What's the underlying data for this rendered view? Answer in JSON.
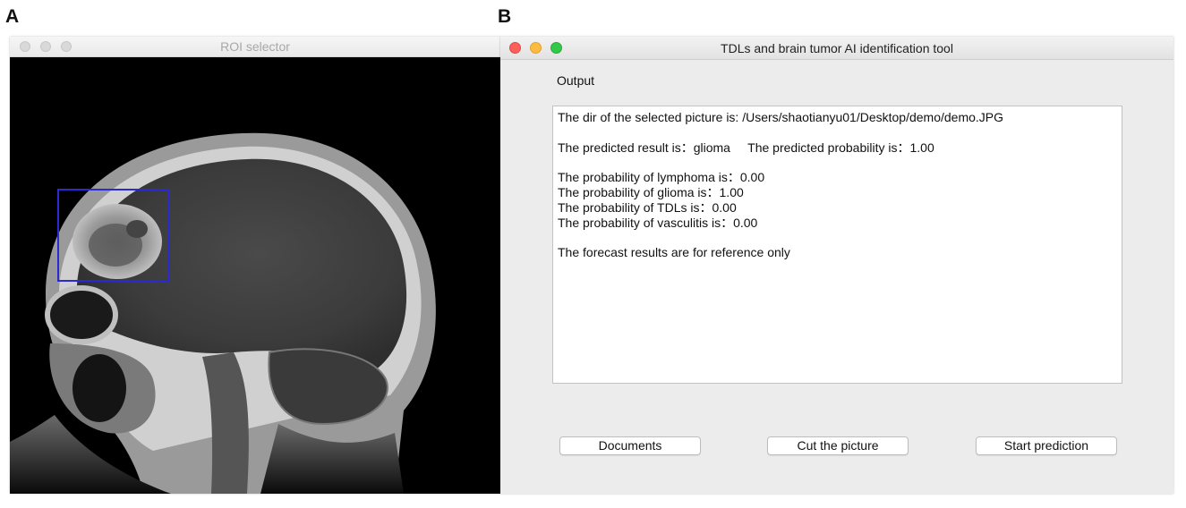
{
  "panels": {
    "left_letter": "A",
    "right_letter": "B"
  },
  "roi_window": {
    "title": "ROI selector"
  },
  "tool_window": {
    "title": "TDLs and brain tumor AI identification tool",
    "output_label": "Output",
    "output_lines": [
      "The dir of the selected picture is: /Users/shaotianyu01/Desktop/demo/demo.JPG",
      "",
      "The predicted result is：glioma     The predicted probability is：1.00",
      "",
      "The probability of lymphoma is：0.00",
      "The probability of glioma is：1.00",
      "The probability of TDLs is：0.00",
      "The probability of vasculitis is：0.00",
      "",
      "The forecast results are for reference only"
    ],
    "buttons": {
      "documents": "Documents",
      "cut": "Cut the picture",
      "start": "Start prediction"
    }
  },
  "colors": {
    "roi_box": "#2a2ad0",
    "close": "#fc605c",
    "minimize": "#fdbc40",
    "maximize": "#34c84a"
  }
}
